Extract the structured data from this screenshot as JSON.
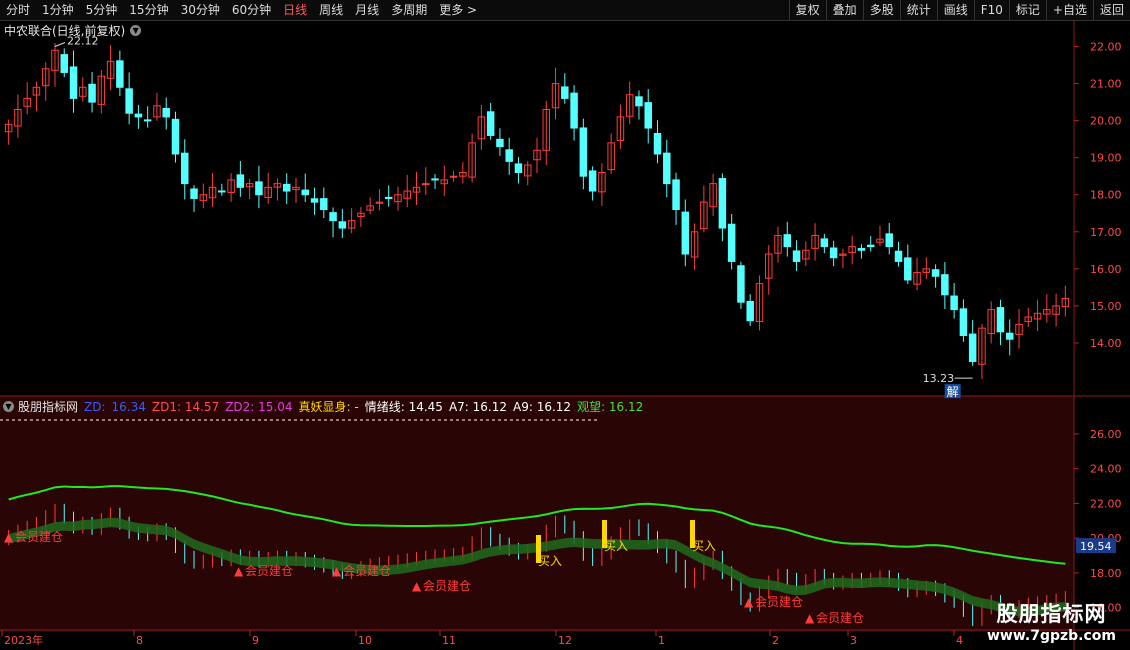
{
  "toolbar": {
    "left": [
      "分时",
      "1分钟",
      "5分钟",
      "15分钟",
      "30分钟",
      "60分钟",
      "日线",
      "周线",
      "月线",
      "多周期",
      "更多 >"
    ],
    "active": "日线",
    "right": [
      "复权",
      "叠加",
      "多股",
      "统计",
      "画线",
      "F10",
      "标记",
      "+自选",
      "返回"
    ]
  },
  "stock": {
    "title": "中农联合(日线,前复权)"
  },
  "price_axis": [
    "22.00",
    "21.00",
    "20.00",
    "19.00",
    "18.00",
    "17.00",
    "16.00",
    "15.00",
    "14.00"
  ],
  "price_high_label": "22.12",
  "price_low_label": "13.23",
  "jie_label": "解",
  "indicator": {
    "name": "股朋指标网",
    "values": [
      {
        "text": "ZD:",
        "color": "#3a5bff"
      },
      {
        "text": "16.34",
        "color": "#3a5bff"
      },
      {
        "text": "ZD1: 14.57",
        "color": "#ff4d4d"
      },
      {
        "text": "ZD2: 15.04",
        "color": "#e33be3"
      },
      {
        "text": "真妖显身: -",
        "color": "#ffd700"
      },
      {
        "text": "情绪线: 14.45",
        "color": "#ffffff"
      },
      {
        "text": "A7: 16.12",
        "color": "#ffffff"
      },
      {
        "text": "A9: 16.12",
        "color": "#ffffff"
      },
      {
        "text": "观望: 16.12",
        "color": "#41e141"
      }
    ],
    "axis": [
      "26.00",
      "24.00",
      "22.00",
      "20.00",
      "18.00",
      "16.00"
    ],
    "current_value": "19.54",
    "buy_label": "买入",
    "build_label": "会员建仓",
    "arrow_glyph": "▲"
  },
  "dates": [
    "2023年",
    "8",
    "9",
    "10",
    "11",
    "12",
    "1",
    "2",
    "3",
    "4"
  ],
  "watermark": {
    "line1": "股朋指标网",
    "line2": "www.7gpzb.com"
  },
  "colors": {
    "up": "#ff3c3c",
    "down": "#54ffff",
    "ma_green": "#22e822",
    "panel_bg": "#2a0505"
  },
  "chart_data": {
    "type": "candlestick",
    "title": "中农联合(日线,前复权)",
    "ylim": [
      13.0,
      22.5
    ],
    "close": [
      19.9,
      20.3,
      20.6,
      20.9,
      21.4,
      21.9,
      21.3,
      20.6,
      20.9,
      20.5,
      21.2,
      21.6,
      20.9,
      20.2,
      20.1,
      20.0,
      20.4,
      20.1,
      19.1,
      18.3,
      17.9,
      18.0,
      18.2,
      18.1,
      18.4,
      18.2,
      18.3,
      18.0,
      18.2,
      18.3,
      18.1,
      18.2,
      18.0,
      17.8,
      17.6,
      17.3,
      17.1,
      17.3,
      17.5,
      17.7,
      17.8,
      17.9,
      18.0,
      18.1,
      18.2,
      18.3,
      18.4,
      18.4,
      18.5,
      18.6,
      19.4,
      20.1,
      19.6,
      19.3,
      18.9,
      18.6,
      18.8,
      19.2,
      20.3,
      21.0,
      20.6,
      19.8,
      18.5,
      18.1,
      18.6,
      19.4,
      20.1,
      20.7,
      20.4,
      19.8,
      19.1,
      18.3,
      17.6,
      16.4,
      17.0,
      17.8,
      18.3,
      17.1,
      16.2,
      15.1,
      14.6,
      15.6,
      16.4,
      16.9,
      16.6,
      16.2,
      16.5,
      16.9,
      16.6,
      16.3,
      16.4,
      16.6,
      16.5,
      16.6,
      16.8,
      16.6,
      16.2,
      15.7,
      15.9,
      16.0,
      15.8,
      15.3,
      14.9,
      14.2,
      13.5,
      14.4,
      14.9,
      14.3,
      14.1,
      14.5,
      14.7,
      14.8,
      14.9,
      15.0,
      15.2
    ]
  }
}
